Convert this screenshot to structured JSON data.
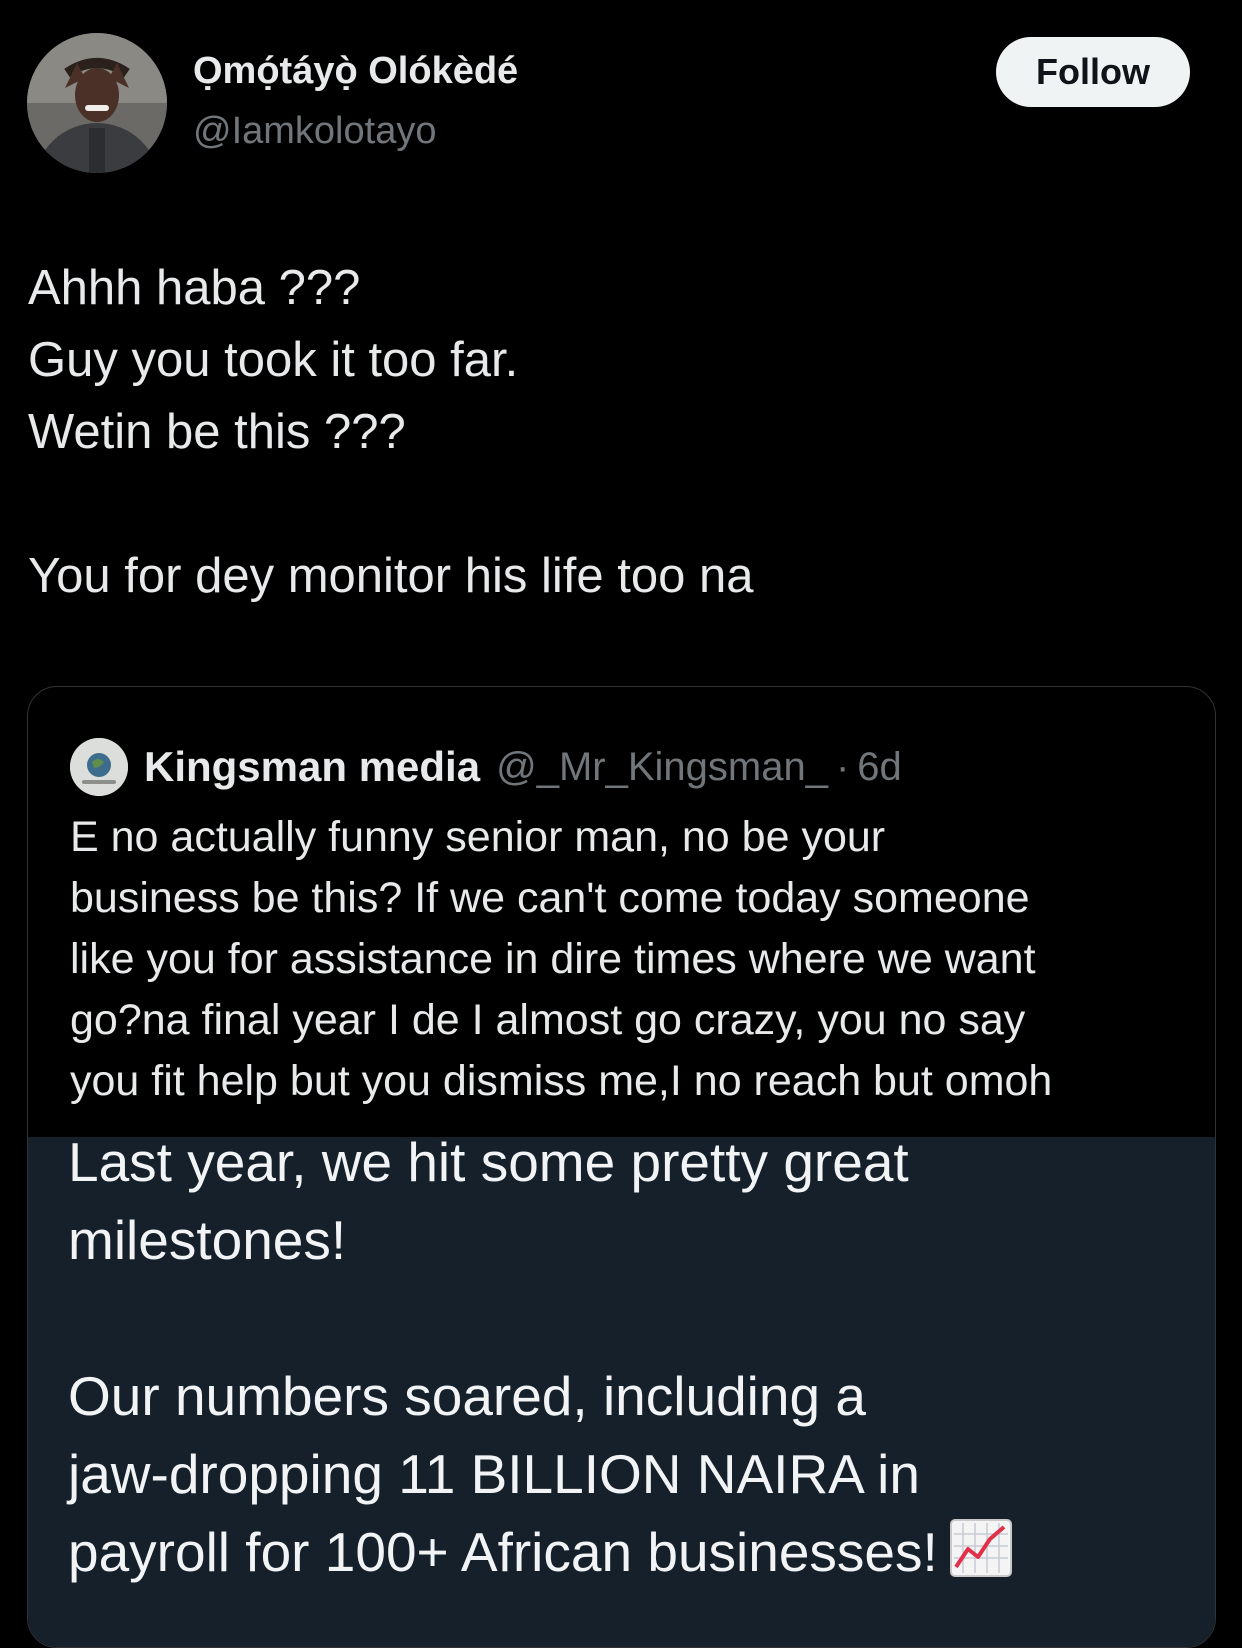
{
  "author": {
    "display_name": "Ọmọ́táyọ̀ Olókèdé",
    "handle": "@Iamkolotayo",
    "avatar_icon": "profile-photo"
  },
  "follow_button": {
    "label": "Follow"
  },
  "tweet": {
    "lines": [
      "Ahhh haba ???",
      "Guy you took it too far.",
      "Wetin be this ???",
      "You for dey monitor his life too na"
    ]
  },
  "quoted_tweet": {
    "display_name": "Kingsman media",
    "handle": "@_Mr_Kingsman_",
    "separator": "·",
    "time": "6d",
    "text_lines": [
      "E no actually funny senior man, no be your",
      "business be this? If we can't come today someone",
      "like you for assistance in dire times where we want",
      "go?na final year I de I almost go crazy, you no say",
      "you fit help but you dismiss me,I no reach but omoh"
    ],
    "image": {
      "text_lines": [
        "Last year, we hit some pretty great",
        "milestones!",
        "Our numbers soared, including a",
        "jaw-dropping 11 BILLION NAIRA in",
        "payroll for 100+ African businesses!"
      ],
      "emoji_icon": "chart-increasing-icon",
      "background": "#15202b"
    }
  },
  "colors": {
    "background": "#000000",
    "text": "#e7e9ea",
    "secondary_text": "#71767b",
    "follow_bg": "#eff3f4",
    "border": "#2f3336"
  }
}
